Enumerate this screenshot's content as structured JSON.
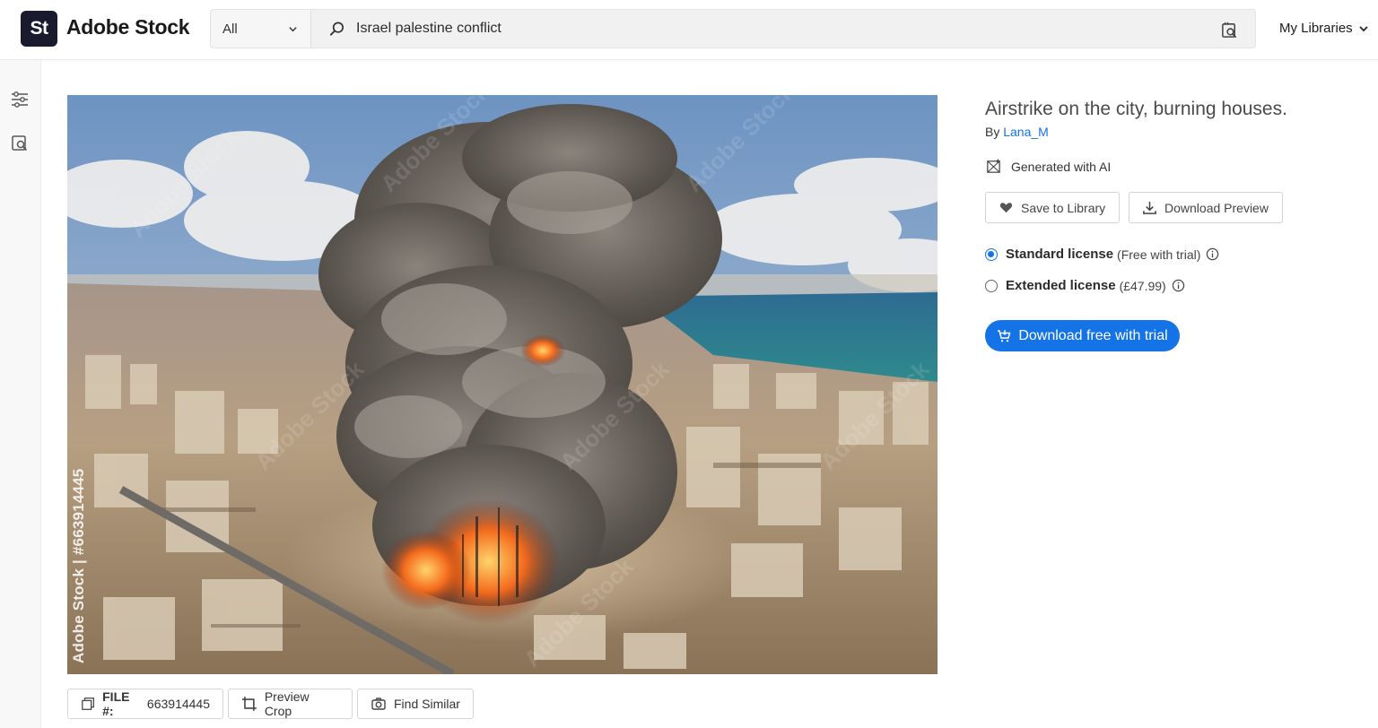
{
  "brand": {
    "badge": "St",
    "name": "Adobe Stock"
  },
  "search": {
    "category": "All",
    "query": "Israel palestine conflict"
  },
  "header": {
    "my_libraries": "My Libraries"
  },
  "asset": {
    "title": "Airstrike on the city, burning houses.",
    "by_prefix": "By",
    "author": "Lana_M",
    "ai_label": "Generated with AI",
    "watermark": "Adobe Stock | #663914445",
    "file_label": "FILE #:",
    "file_number": "663914445"
  },
  "actions": {
    "save_to_library": "Save to Library",
    "download_preview": "Download Preview",
    "preview_crop": "Preview Crop",
    "find_similar": "Find Similar",
    "download_cta": "Download free with trial"
  },
  "licenses": [
    {
      "name": "Standard license",
      "detail": "(Free with trial)",
      "selected": true
    },
    {
      "name": "Extended license",
      "detail": "(£47.99)",
      "selected": false
    }
  ],
  "colors": {
    "accent": "#1473e6",
    "brand_badge": "#1a1a2e"
  }
}
